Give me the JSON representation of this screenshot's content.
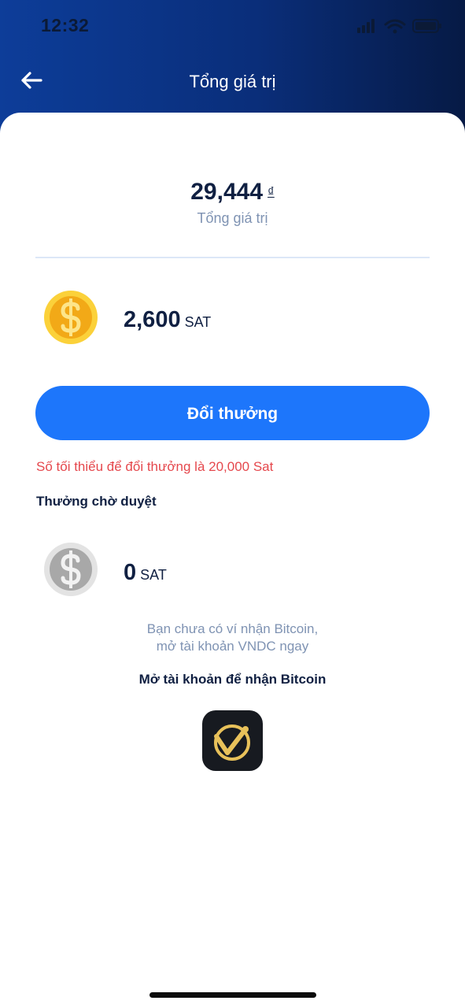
{
  "status_bar": {
    "time": "12:32"
  },
  "header": {
    "title": "Tổng giá trị"
  },
  "summary": {
    "total_value": "29,444",
    "currency_symbol": "₫",
    "total_label": "Tổng giá trị"
  },
  "balance": {
    "amount": "2,600",
    "unit": "SAT"
  },
  "redeem": {
    "button_label": "Đổi thưởng",
    "minimum_note": "Số tối thiểu để đổi thưởng là 20,000 Sat"
  },
  "pending": {
    "heading": "Thưởng chờ duyệt",
    "amount": "0",
    "unit": "SAT"
  },
  "wallet_prompt": {
    "line1": "Bạn chưa có ví nhận Bitcoin,",
    "line2": "mở tài khoản VNDC ngay",
    "cta_label": "Mở tài khoản để nhận Bitcoin"
  },
  "icons": {
    "back": "back-arrow-icon",
    "gold_coin": "gold-coin-icon",
    "silver_coin": "silver-coin-icon",
    "app": "vndc-app-icon",
    "signal": "signal-icon",
    "wifi": "wifi-icon",
    "battery": "battery-icon"
  },
  "colors": {
    "header_start": "#0d3d99",
    "header_end": "#061a45",
    "primary_button": "#1d76fb",
    "warning_text": "#e5484d",
    "dark_text": "#102042",
    "muted_text": "#7f93b3"
  }
}
